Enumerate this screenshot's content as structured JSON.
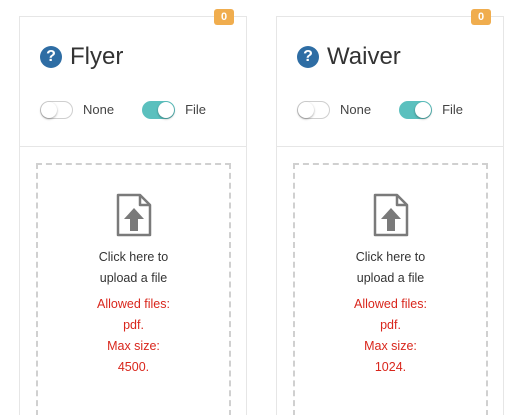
{
  "cards": [
    {
      "badge": "0",
      "title": "Flyer",
      "toggles": [
        {
          "label": "None",
          "state": "off"
        },
        {
          "label": "File",
          "state": "on"
        }
      ],
      "upload": {
        "prompt_line1": "Click here to",
        "prompt_line2": "upload a file",
        "allowed_label": "Allowed files:",
        "allowed_value": "pdf.",
        "max_label": "Max size:",
        "max_value": "4500."
      }
    },
    {
      "badge": "0",
      "title": "Waiver",
      "toggles": [
        {
          "label": "None",
          "state": "off"
        },
        {
          "label": "File",
          "state": "on"
        }
      ],
      "upload": {
        "prompt_line1": "Click here to",
        "prompt_line2": "upload a file",
        "allowed_label": "Allowed files:",
        "allowed_value": "pdf.",
        "max_label": "Max size:",
        "max_value": "1024."
      }
    }
  ],
  "icons": {
    "help": "question-circle-icon",
    "upload": "file-upload-icon"
  },
  "colors": {
    "badge": "#f0ad4e",
    "help_icon": "#2e6da4",
    "toggle_on": "#5bc0be",
    "rules_text": "#d9261c",
    "dropzone_border": "#d0d0d0"
  }
}
